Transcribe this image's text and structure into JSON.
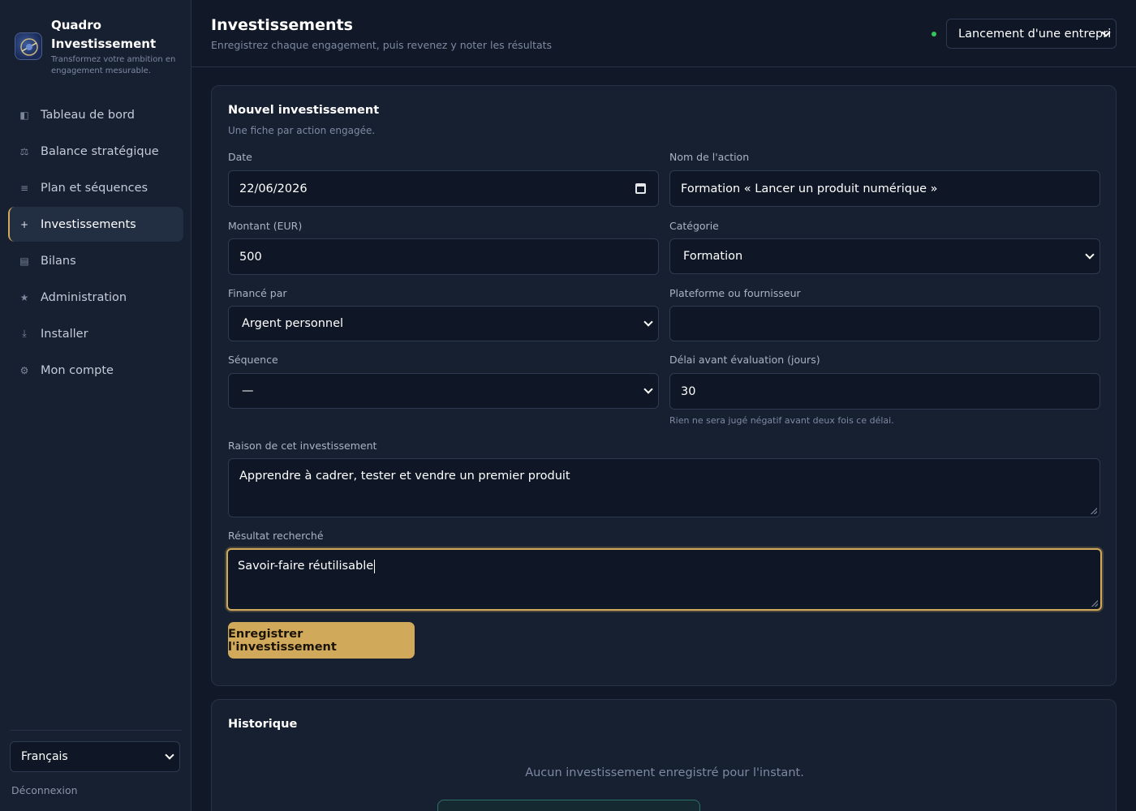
{
  "app": {
    "name": "Quadro Investissement",
    "tagline": "Transformez votre ambition en engagement mesurable."
  },
  "sidebar": {
    "items": [
      {
        "label": "Tableau de bord",
        "icon": "dashboard-icon",
        "glyph": "◧"
      },
      {
        "label": "Balance stratégique",
        "icon": "balance-icon",
        "glyph": "⚖"
      },
      {
        "label": "Plan et séquences",
        "icon": "list-icon",
        "glyph": "≡"
      },
      {
        "label": "Investissements",
        "icon": "plus-icon",
        "glyph": "+",
        "active": true
      },
      {
        "label": "Bilans",
        "icon": "report-icon",
        "glyph": "▤"
      },
      {
        "label": "Administration",
        "icon": "star-icon",
        "glyph": "★"
      },
      {
        "label": "Installer",
        "icon": "download-icon",
        "glyph": "⤓"
      },
      {
        "label": "Mon compte",
        "icon": "gear-icon",
        "glyph": "⚙"
      }
    ],
    "language": "Français",
    "logout": "Déconnexion"
  },
  "header": {
    "title": "Investissements",
    "subtitle": "Enregistrez chaque engagement, puis revenez y noter les résultats",
    "project": "Lancement d'une entrepri",
    "status_color": "#34c759"
  },
  "form": {
    "title": "Nouvel investissement",
    "subtitle": "Une fiche par action engagée.",
    "date_label": "Date",
    "date_value": "22/06/2026",
    "action_label": "Nom de l'action",
    "action_value": "Formation « Lancer un produit numérique »",
    "amount_label": "Montant (EUR)",
    "amount_value": "500",
    "category_label": "Catégorie",
    "category_value": "Formation",
    "funded_label": "Financé par",
    "funded_value": "Argent personnel",
    "platform_label": "Plateforme ou fournisseur",
    "platform_value": "",
    "sequence_label": "Séquence",
    "sequence_value": "—",
    "delay_label": "Délai avant évaluation (jours)",
    "delay_value": "30",
    "delay_hint": "Rien ne sera jugé négatif avant deux fois ce délai.",
    "reason_label": "Raison de cet investissement",
    "reason_value": "Apprendre à cadrer, tester et vendre un premier produit",
    "result_label": "Résultat recherché",
    "result_value": "Savoir-faire réutilisable",
    "submit": "Enregistrer l'investissement"
  },
  "history": {
    "title": "Historique",
    "empty": "Aucun investissement enregistré pour l'instant."
  },
  "colors": {
    "accent": "#d1a95a",
    "background": "#111827",
    "panel": "#172031"
  }
}
